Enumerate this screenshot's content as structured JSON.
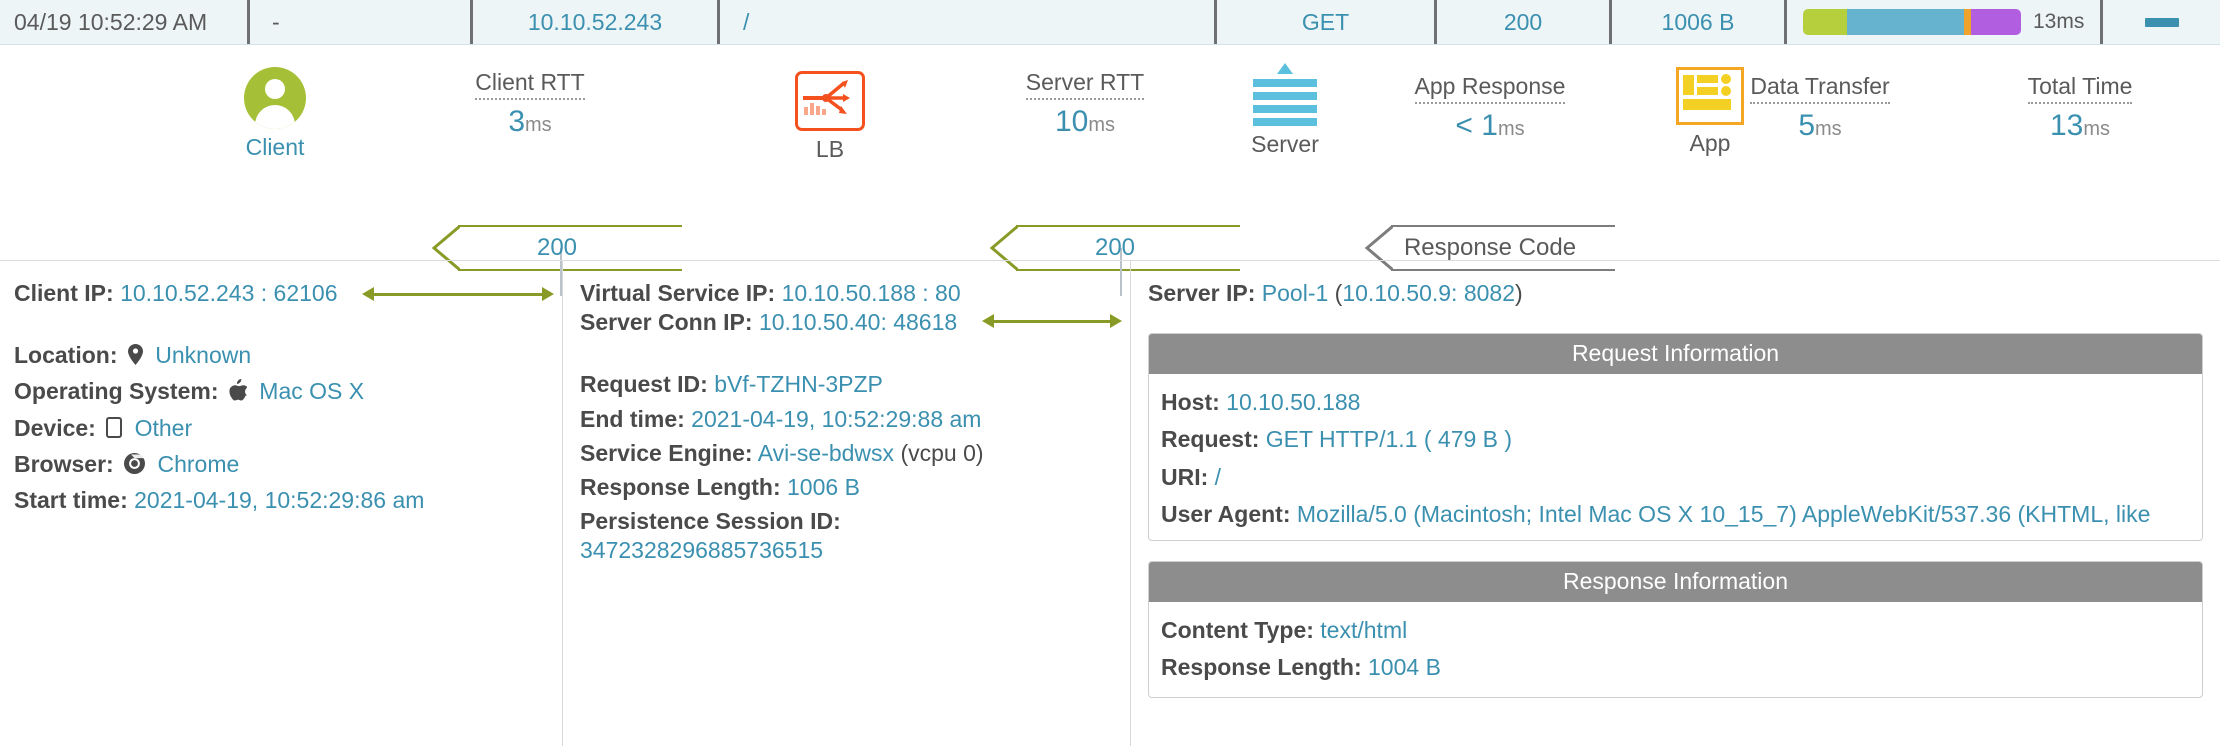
{
  "header": {
    "timestamp": "04/19 10:52:29 AM",
    "dash": "-",
    "client_ip": "10.10.52.243",
    "uri": "/",
    "method": "GET",
    "status": "200",
    "size": "1006 B",
    "total_time": "13ms",
    "collapse_icon": "minus-icon",
    "timing_segments": [
      {
        "name": "client-rtt",
        "color": "#b5cf3d",
        "pct": 20
      },
      {
        "name": "server-rtt",
        "color": "#66b3d0",
        "pct": 54
      },
      {
        "name": "app-response",
        "color": "#f0a32a",
        "pct": 3
      },
      {
        "name": "data-transfer",
        "color": "#b15fe0",
        "pct": 23
      }
    ]
  },
  "flow": {
    "nodes": [
      {
        "label": "Client",
        "icon": "client-avatar-icon"
      },
      {
        "label": "LB",
        "icon": "load-balancer-icon"
      },
      {
        "label": "Server",
        "icon": "server-icon"
      },
      {
        "label": "App",
        "icon": "app-icon"
      }
    ],
    "metrics": [
      {
        "title": "Client RTT",
        "value": "3",
        "unit": "ms"
      },
      {
        "title": "Server RTT",
        "value": "10",
        "unit": "ms"
      },
      {
        "title": "App Response",
        "value": "< 1",
        "unit": "ms"
      },
      {
        "title": "Data Transfer",
        "value": "5",
        "unit": "ms"
      },
      {
        "title": "Total Time",
        "value": "13",
        "unit": "ms"
      }
    ],
    "banners": [
      {
        "text": "200",
        "color": "#8a9a26"
      },
      {
        "text": "200",
        "color": "#8a9a26"
      },
      {
        "text": "Response Code",
        "color": "#7d7d7d"
      }
    ]
  },
  "client_column": {
    "client_ip_label": "Client IP:",
    "client_ip_value": "10.10.52.243 : 62106",
    "location_label": "Location:",
    "location_value": "Unknown",
    "location_icon": "map-pin-icon",
    "os_label": "Operating System:",
    "os_value": "Mac OS X",
    "os_icon": "apple-icon",
    "device_label": "Device:",
    "device_value": "Other",
    "device_icon": "tablet-icon",
    "browser_label": "Browser:",
    "browser_value": "Chrome",
    "browser_icon": "chrome-icon",
    "start_label": "Start time:",
    "start_value": "2021-04-19, 10:52:29:86 am"
  },
  "lb_column": {
    "vs_ip_label": "Virtual Service IP:",
    "vs_ip_value": "10.10.50.188 : 80",
    "conn_ip_label": "Server Conn IP:",
    "conn_ip_value": "10.10.50.40: 48618",
    "request_id_label": "Request ID:",
    "request_id_value": "bVf-TZHN-3PZP",
    "end_time_label": "End time:",
    "end_time_value": "2021-04-19, 10:52:29:88 am",
    "se_label": "Service Engine:",
    "se_value": "Avi-se-bdwsx",
    "se_suffix": "(vcpu 0)",
    "resp_len_label": "Response Length:",
    "resp_len_value": "1006 B",
    "persist_label": "Persistence Session ID:",
    "persist_value": "3472328296885736515"
  },
  "server_column": {
    "server_ip_label": "Server IP:",
    "server_ip_pool": "Pool-1",
    "server_ip_open": "(",
    "server_ip_addr": "10.10.50.9: 8082",
    "server_ip_close": ")",
    "request_panel": {
      "title": "Request Information",
      "host_label": "Host:",
      "host_value": "10.10.50.188",
      "request_label": "Request:",
      "request_value": "GET HTTP/1.1 ( 479 B )",
      "uri_label": "URI:",
      "uri_value": "/",
      "ua_label": "User Agent:",
      "ua_value": "Mozilla/5.0 (Macintosh; Intel Mac OS X 10_15_7) AppleWebKit/537.36 (KHTML, like"
    },
    "response_panel": {
      "title": "Response Information",
      "content_type_label": "Content Type:",
      "content_type_value": "text/html",
      "resp_len_label": "Response Length:",
      "resp_len_value": "1004 B"
    }
  },
  "colors": {
    "link": "#3b90b0",
    "accent_green": "#a5c036",
    "accent_orange": "#f4511e",
    "panel_head": "#8d8d8d"
  }
}
